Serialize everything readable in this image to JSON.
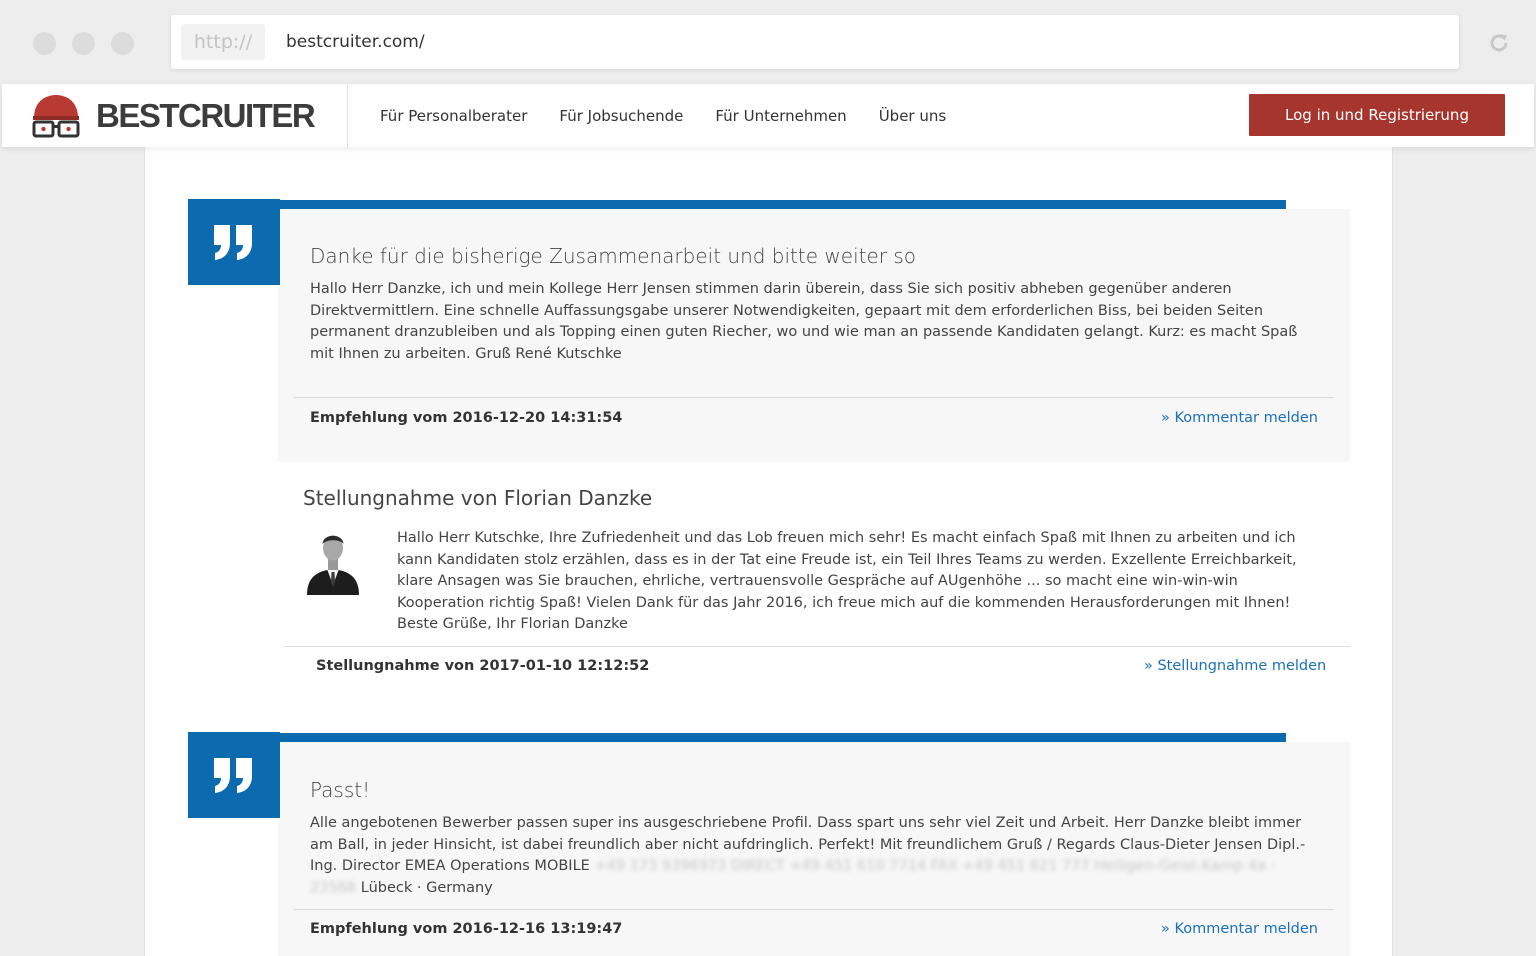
{
  "browser": {
    "protocol": "http://",
    "url": "bestcruiter.com/"
  },
  "header": {
    "logo_text": "BESTCRUITER",
    "nav": [
      "Für Personalberater",
      "Für Jobsuchende",
      "Für Unternehmen",
      "Über uns"
    ],
    "login_button": "Log in und Registrierung",
    "accent_color": "#a6362d"
  },
  "reviews": [
    {
      "title": "Danke für die bisherige Zusammenarbeit und bitte weiter so",
      "body": "Hallo Herr Danzke, ich und mein Kollege Herr Jensen stimmen darin überein, dass Sie sich positiv abheben gegenüber anderen Direktvermittlern. Eine schnelle Auffassungsgabe unserer Notwendigkeiten, gepaart mit dem erforderlichen Biss, bei beiden Seiten permanent dranzubleiben und als Topping einen guten Riecher, wo und wie man an passende Kandidaten gelangt. Kurz: es macht Spaß mit Ihnen zu arbeiten. Gruß René Kutschke",
      "meta": "Empfehlung vom 2016-12-20 14:31:54",
      "report_link": "» Kommentar melden"
    },
    {
      "title": "Passt!",
      "body_start": "Alle angebotenen Bewerber passen super ins ausgeschriebene Profil. Dass spart uns sehr viel Zeit und Arbeit. Herr Danzke bleibt immer am Ball, in jeder Hinsicht, ist dabei freundlich aber nicht aufdringlich. Perfekt! Mit freundlichem Gruß / Regards Claus-Dieter Jensen Dipl.-Ing. Director EMEA Operations MOBILE",
      "body_blurred": "+49 173 9396973 DIRECT +49 451 610 7714 FAX +49 451 621 777 Heiligen-Geist-Kamp 4a · 23568",
      "body_end": "Lübeck · Germany",
      "meta": "Empfehlung vom 2016-12-16 13:19:47",
      "report_link": "» Kommentar melden"
    }
  ],
  "response": {
    "title": "Stellungnahme von Florian Danzke",
    "body": "Hallo Herr Kutschke, Ihre Zufriedenheit und das Lob freuen mich sehr! Es macht einfach Spaß mit Ihnen zu arbeiten und ich kann Kandidaten stolz erzählen, dass es in der Tat eine Freude ist, ein Teil Ihres Teams zu werden. Exzellente Erreichbarkeit, klare Ansagen was Sie brauchen, ehrliche, vertrauensvolle Gespräche auf AUgenhöhe ... so macht eine win-win-win Kooperation richtig Spaß! Vielen Dank für das Jahr 2016, ich freue mich auf die kommenden Herausforderungen mit Ihnen! Beste Grüße, Ihr Florian Danzke",
    "meta": "Stellungnahme von 2017-01-10 12:12:52",
    "report_link": "» Stellungnahme melden"
  },
  "colors": {
    "brand_blue": "#0c6aae",
    "link_blue": "#1b70b8"
  }
}
